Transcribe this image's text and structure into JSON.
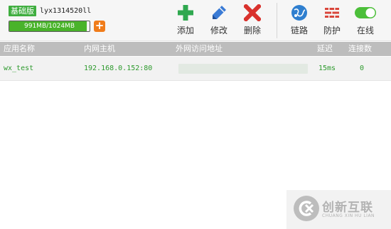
{
  "account": {
    "plan_badge": "基础版",
    "username": "lyx1314520ll",
    "traffic_text": "991MB/1024MB",
    "traffic_used_fraction": 0.968,
    "add_traffic_symbol": "+"
  },
  "toolbar": {
    "add_label": "添加",
    "edit_label": "修改",
    "delete_label": "删除",
    "link_label": "链路",
    "protect_label": "防护",
    "online_label": "在线"
  },
  "table": {
    "columns": [
      "应用名称",
      "内网主机",
      "外网访问地址",
      "延迟",
      "连接数"
    ],
    "rows": [
      {
        "app_name": "wx_test",
        "internal_host": "192.168.0.152:80",
        "external_address": "",
        "latency": "15ms",
        "connections": "0"
      }
    ]
  },
  "watermark": {
    "title": "创新互联",
    "subtitle": "CHUANG XIN HU LIAN"
  },
  "colors": {
    "accent_green": "#3fae3f",
    "traffic_fill": "#49b32a",
    "add_icon": "#2fa84f",
    "edit_icon": "#3a7bd5",
    "delete_icon": "#d9322d",
    "link_icon": "#2f7fcf",
    "protect_icon": "#d9453a",
    "toggle_on": "#4cbf3a",
    "header_row": "#bdbdbd"
  },
  "icons": {
    "add": "plus-icon",
    "edit": "pencil-icon",
    "delete": "x-icon",
    "link": "globe-icon",
    "protect": "firewall-icon",
    "online": "toggle-icon"
  }
}
